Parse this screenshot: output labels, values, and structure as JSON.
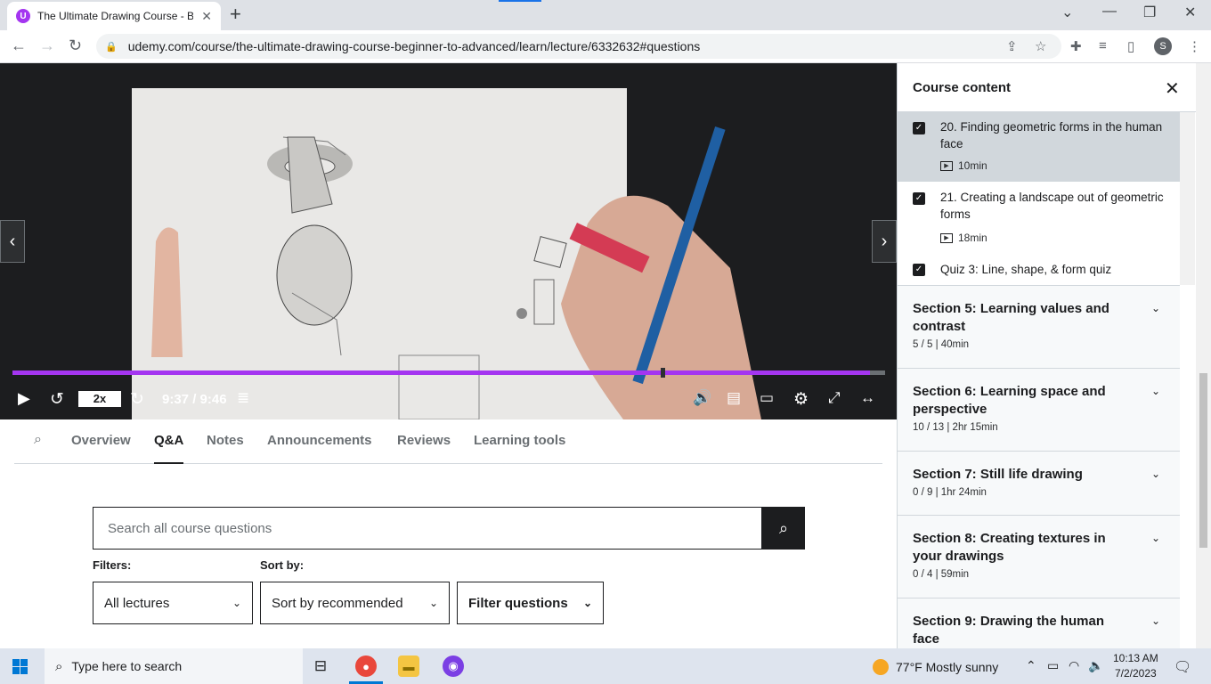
{
  "browser": {
    "tab_title": "The Ultimate Drawing Course - B",
    "url": "udemy.com/course/the-ultimate-drawing-course-beginner-to-advanced/learn/lecture/6332632#questions",
    "profile_initial": "S"
  },
  "player": {
    "speed": "2x",
    "time": "9:37 / 9:46",
    "progress_fraction": 0.9829
  },
  "lecture_tabs": [
    "Overview",
    "Q&A",
    "Notes",
    "Announcements",
    "Reviews",
    "Learning tools"
  ],
  "active_tab": "Q&A",
  "qa": {
    "search_placeholder": "Search all course questions",
    "filters_label": "Filters:",
    "sortby_label": "Sort by:",
    "filter_value": "All lectures",
    "sort_value": "Sort by recommended",
    "filter_questions": "Filter questions"
  },
  "sidebar": {
    "title": "Course content",
    "lectures": [
      {
        "title": "20. Finding geometric forms in the human face",
        "duration": "10min",
        "checked": true,
        "current": true
      },
      {
        "title": "21. Creating a landscape out of geometric forms",
        "duration": "18min",
        "checked": true,
        "current": false
      },
      {
        "title": "Quiz 3: Line, shape, & form quiz",
        "duration": "",
        "checked": true,
        "current": false
      }
    ],
    "sections": [
      {
        "title": "Section 5: Learning values and contrast",
        "meta": "5 / 5 | 40min"
      },
      {
        "title": "Section 6: Learning space and perspective",
        "meta": "10 / 13 | 2hr 15min"
      },
      {
        "title": "Section 7: Still life drawing",
        "meta": "0 / 9 | 1hr 24min"
      },
      {
        "title": "Section 8: Creating textures in your drawings",
        "meta": "0 / 4 | 59min"
      },
      {
        "title": "Section 9: Drawing the human face",
        "meta": ""
      }
    ]
  },
  "taskbar": {
    "search_placeholder": "Type here to search",
    "weather": "77°F  Mostly sunny",
    "time": "10:13 AM",
    "date": "7/2/2023"
  },
  "colors": {
    "accent": "#a435f0",
    "dark": "#1c1d1f"
  }
}
